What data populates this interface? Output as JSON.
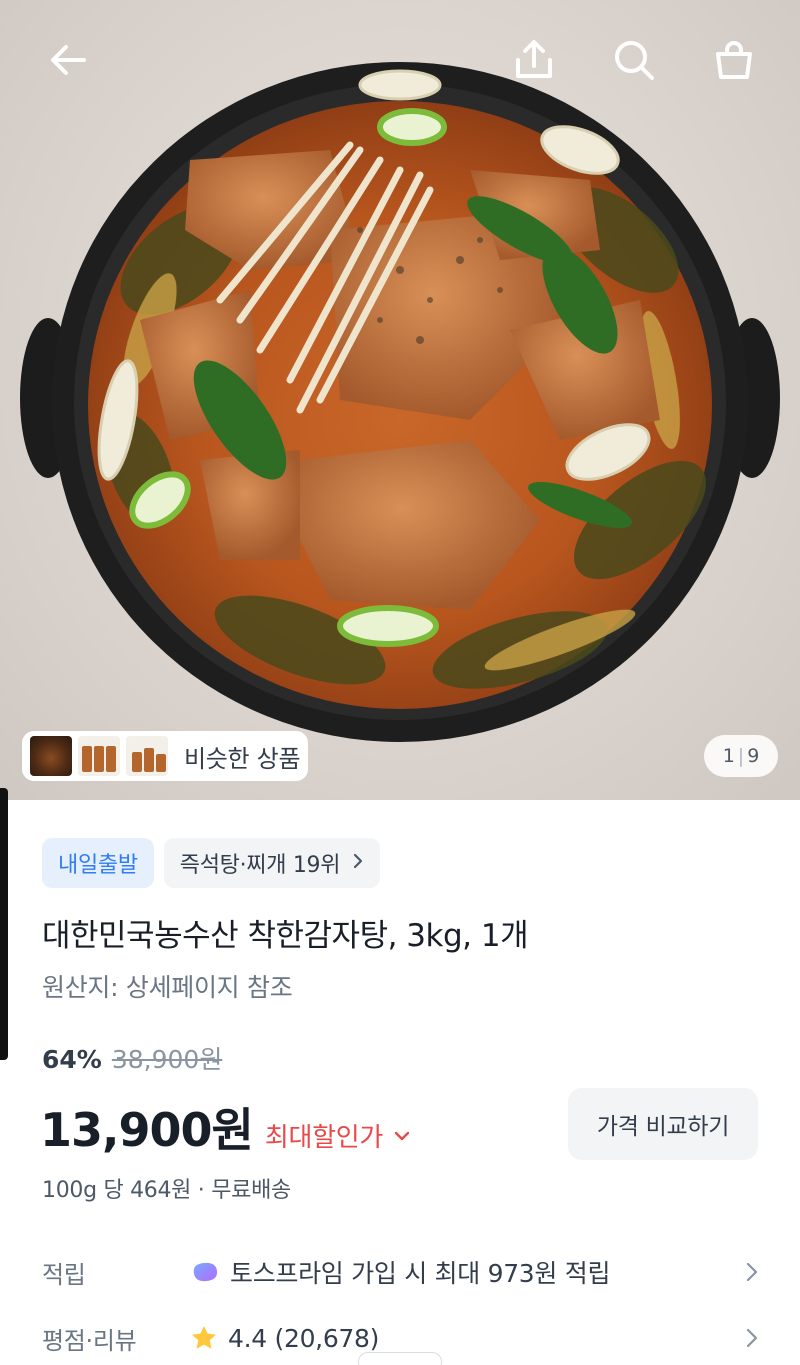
{
  "topbar": {
    "back_icon": "arrow-left-icon",
    "share_icon": "share-upload-icon",
    "search_icon": "search-icon",
    "cart_icon": "shopping-bag-icon"
  },
  "gallery": {
    "similar_label": "비슷한 상품",
    "current": "1",
    "total": "9"
  },
  "product": {
    "badge_delivery": "내일출발",
    "badge_rank": "즉석탕·찌개 19위",
    "title": "대한민국농수산 착한감자탕, 3kg, 1개",
    "origin": "원산지: 상세페이지 참조",
    "discount_rate": "64%",
    "original_price": "38,900원",
    "price": "13,900원",
    "max_discount_label": "최대할인가",
    "compare_button": "가격 비교하기",
    "unit_price_shipping": "100g 당 464원 · 무료배송"
  },
  "rows": [
    {
      "label": "적립",
      "value": "토스프라임 가입 시 최대 973원 적립",
      "icon": "toss-prime-icon"
    },
    {
      "label": "평점·리뷰",
      "value": "4.4 (20,678)",
      "icon": "star-icon"
    }
  ],
  "colors": {
    "blue_badge_text": "#2f7cf6",
    "blue_badge_bg": "#e6f0fd",
    "sale_red": "#e84a4a",
    "star_yellow": "#ffc83d"
  }
}
